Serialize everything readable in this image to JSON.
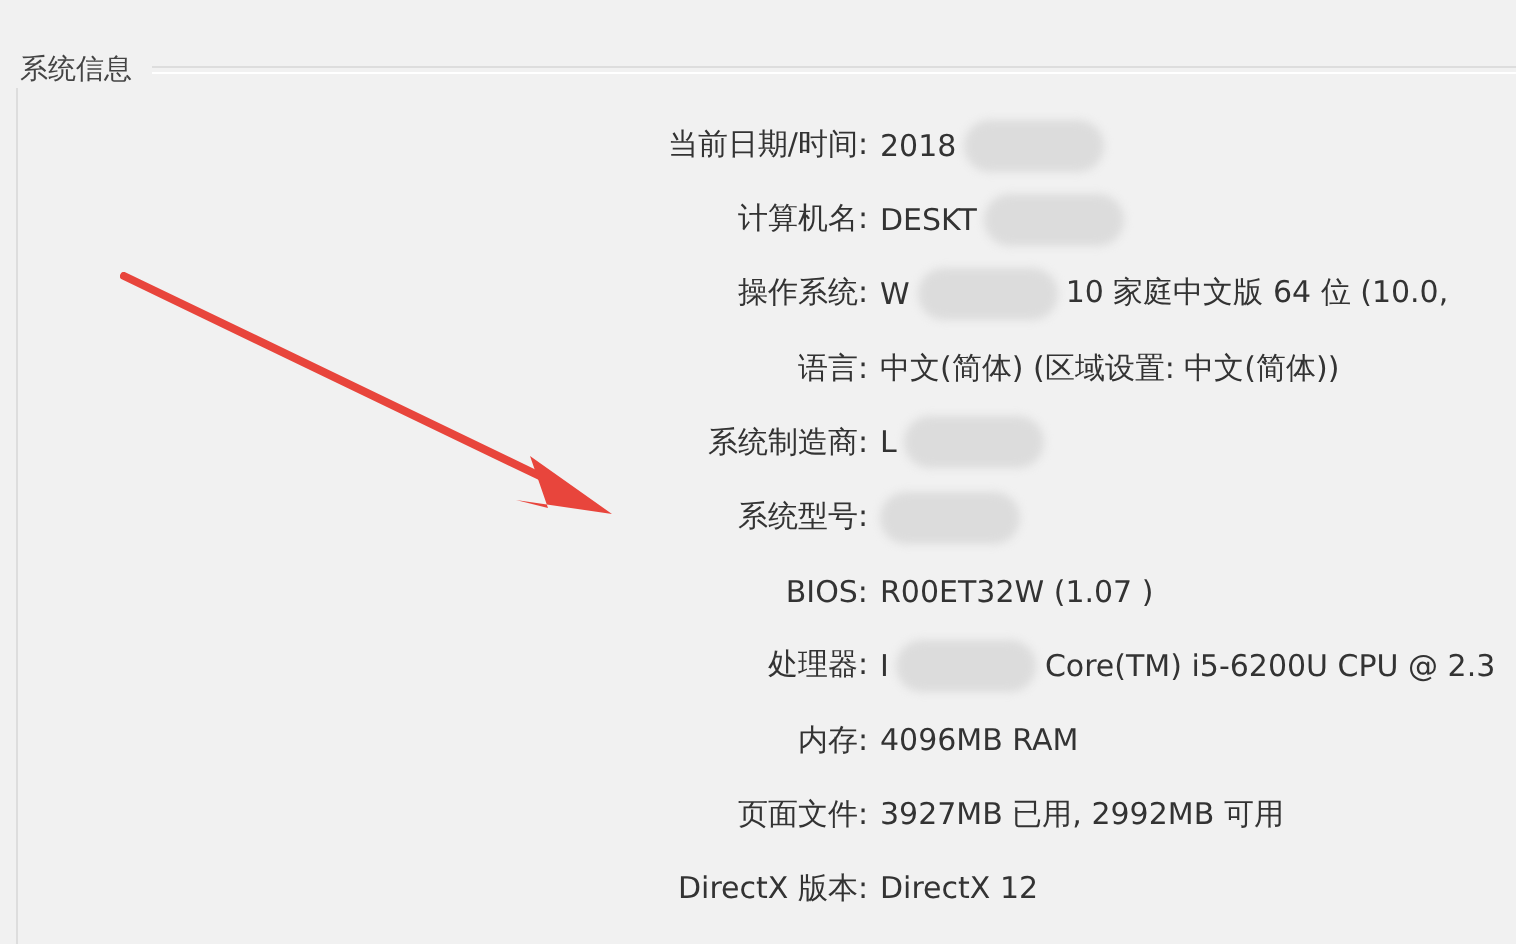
{
  "group": {
    "title": "系统信息"
  },
  "rows": [
    {
      "label": "当前日期/时间:",
      "value": [
        {
          "kind": "text",
          "text": "2018"
        },
        {
          "kind": "blur"
        }
      ]
    },
    {
      "label": "计算机名:",
      "value": [
        {
          "kind": "text",
          "text": "DESKT"
        },
        {
          "kind": "blur"
        }
      ]
    },
    {
      "label": "操作系统:",
      "value": [
        {
          "kind": "text",
          "text": "W"
        },
        {
          "kind": "blur"
        },
        {
          "kind": "text",
          "text": "10 家庭中文版 64 位 (10.0,"
        }
      ]
    },
    {
      "label": "语言:",
      "value": [
        {
          "kind": "text",
          "text": "中文(简体) (区域设置: 中文(简体))"
        }
      ]
    },
    {
      "label": "系统制造商:",
      "value": [
        {
          "kind": "text",
          "text": "L"
        },
        {
          "kind": "blur"
        }
      ]
    },
    {
      "label": "系统型号:",
      "value": [
        {
          "kind": "blur"
        }
      ]
    },
    {
      "label": "BIOS:",
      "value": [
        {
          "kind": "text",
          "text": "R00ET32W (1.07 )"
        }
      ]
    },
    {
      "label": "处理器:",
      "value": [
        {
          "kind": "text",
          "text": "I"
        },
        {
          "kind": "blur"
        },
        {
          "kind": "text",
          "text": "Core(TM) i5-6200U CPU @ 2.3"
        }
      ]
    },
    {
      "label": "内存:",
      "value": [
        {
          "kind": "text",
          "text": "4096MB RAM"
        }
      ]
    },
    {
      "label": "页面文件:",
      "value": [
        {
          "kind": "text",
          "text": "3927MB 已用, 2992MB 可用"
        }
      ]
    },
    {
      "label": "DirectX 版本:",
      "value": [
        {
          "kind": "text",
          "text": "DirectX 12"
        }
      ]
    }
  ]
}
